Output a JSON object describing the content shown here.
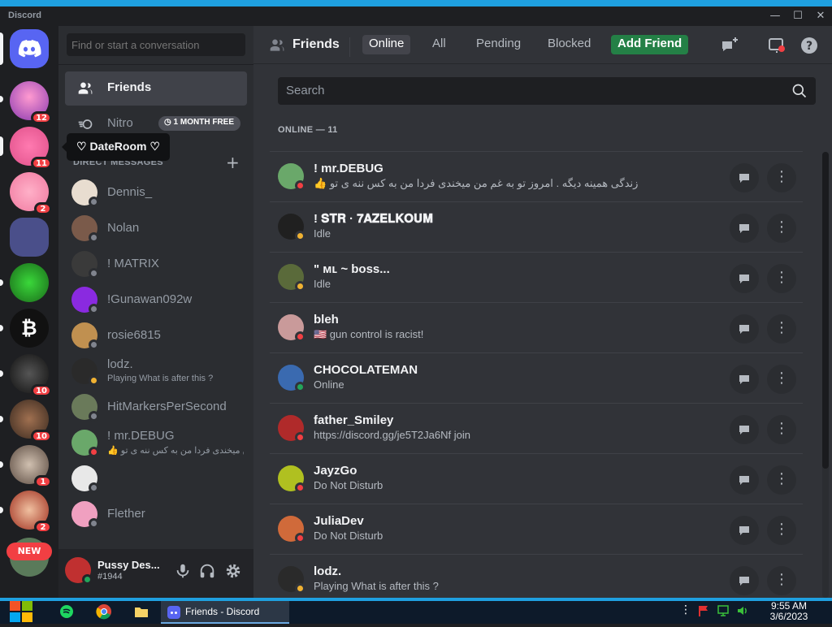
{
  "window": {
    "title": "Discord"
  },
  "rail": {
    "badges": [
      "12",
      "11",
      "2",
      "10",
      "10",
      "1",
      "2"
    ],
    "new_label": "NEW"
  },
  "tooltip": {
    "label": "♡ DateRoom ♡"
  },
  "dm_sidebar": {
    "search_placeholder": "Find or start a conversation",
    "friends_label": "Friends",
    "nitro_label": "Nitro",
    "nitro_promo": "1 MONTH FREE",
    "dm_header": "DIRECT MESSAGES",
    "dms": [
      {
        "name": "Dennis_",
        "sub": "",
        "status": "offline"
      },
      {
        "name": "Nolan",
        "sub": "",
        "status": "offline"
      },
      {
        "name": "! MATRIX",
        "sub": "",
        "status": "offline"
      },
      {
        "name": "!Gunawan092w",
        "sub": "",
        "status": "offline"
      },
      {
        "name": "rosie6815",
        "sub": "",
        "status": "offline"
      },
      {
        "name": "lodz.",
        "sub": "Playing What is after this ?",
        "status": "idle"
      },
      {
        "name": "HitMarkersPerSecond",
        "sub": "",
        "status": "offline"
      },
      {
        "name": "! mr.DEBUG",
        "sub": "👍 زندگی همینه دیگه . امروز تو به غم من میخندی فردا من به کس ننه ی تو",
        "status": "dnd"
      },
      {
        "name": "",
        "sub": "",
        "status": "offline"
      },
      {
        "name": "Flether",
        "sub": "",
        "status": "offline"
      }
    ]
  },
  "user_panel": {
    "name": "Pussy Des...",
    "tag": "#1944"
  },
  "topbar": {
    "title": "Friends",
    "tabs": [
      "Online",
      "All",
      "Pending",
      "Blocked"
    ],
    "add_friend": "Add Friend"
  },
  "search": {
    "placeholder": "Search"
  },
  "online_header": "ONLINE — 11",
  "friends": [
    {
      "name": "! mr.DEBUG",
      "status_text": "👍 زندگی همینه دیگه . امروز تو به غم من میخندی فردا من به کس ننه ی تو",
      "status": "dnd",
      "color": "#6aa86a"
    },
    {
      "name": "! 𝐒𝐓𝐑 · 𝟕𝐀𝐙𝐄𝐋𝐊𝐎𝐔𝐌",
      "status_text": "Idle",
      "status": "idle",
      "color": "#202020"
    },
    {
      "name": "\"   ᴍʟ  ~ boss...",
      "status_text": "Idle",
      "status": "idle",
      "color": "#5a6a3a"
    },
    {
      "name": "bleh",
      "status_text": "🇺🇸 gun control is racist!",
      "status": "dnd",
      "color": "#c99a9a"
    },
    {
      "name": "CHOCOLATEMAN",
      "status_text": "Online",
      "status": "online",
      "color": "#3a6ab0"
    },
    {
      "name": "father_Smiley",
      "status_text": "https://discord.gg/je5T2Ja6Nf join",
      "status": "dnd",
      "color": "#b02a2a"
    },
    {
      "name": "JayzGo",
      "status_text": "Do Not Disturb",
      "status": "dnd",
      "color": "#b0c020"
    },
    {
      "name": "JuliaDev",
      "status_text": "Do Not Disturb",
      "status": "dnd",
      "color": "#d06a3a"
    },
    {
      "name": "lodz.",
      "status_text": "Playing What is after this ?",
      "status": "idle",
      "color": "#2a2a2a"
    }
  ],
  "taskbar": {
    "active_task": "Friends - Discord",
    "time": "9:55 AM",
    "date": "3/6/2023"
  },
  "colors": {
    "blurple": "#5865f2",
    "green": "#248046",
    "red": "#f23f43",
    "idle": "#f0b232",
    "online": "#23a55a"
  }
}
